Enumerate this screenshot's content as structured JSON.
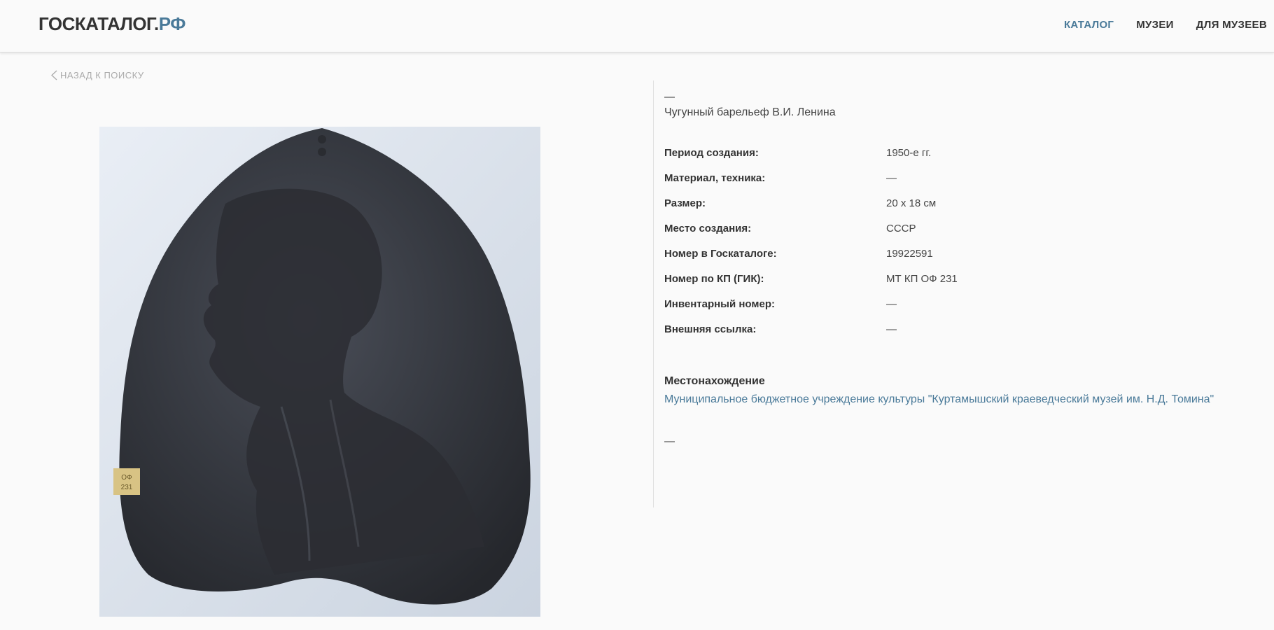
{
  "header": {
    "logo_main": "ГОСКАТАЛОГ.",
    "logo_accent": "РФ",
    "nav": [
      {
        "label": "КАТАЛОГ",
        "active": true
      },
      {
        "label": "МУЗЕИ",
        "active": false
      },
      {
        "label": "ДЛЯ МУЗЕЕВ",
        "active": false
      }
    ]
  },
  "back_link": {
    "label": "НАЗАД К ПОИСКУ",
    "icon": "chevron-left-icon"
  },
  "item": {
    "author": "—",
    "title": "Чугунный барельеф В.И. Ленина",
    "properties": [
      {
        "label": "Период создания:",
        "value": "1950-е гг."
      },
      {
        "label": "Материал, техника:",
        "value": "—"
      },
      {
        "label": "Размер:",
        "value": "20 х 18 см"
      },
      {
        "label": "Место создания:",
        "value": "СССР"
      },
      {
        "label": "Номер в Госкаталоге:",
        "value": "19922591"
      },
      {
        "label": "Номер по КП (ГИК):",
        "value": "МТ КП ОФ 231"
      },
      {
        "label": "Инвентарный номер:",
        "value": "—"
      },
      {
        "label": "Внешняя ссылка:",
        "value": "—"
      }
    ],
    "location_title": "Местонахождение",
    "location_link": "Муниципальное бюджетное учреждение культуры \"Куртамышский краеведческий музей им. Н.Д. Томина\"",
    "footer_dash": "—"
  },
  "photo": {
    "label_text": "ОФ 231"
  },
  "colors": {
    "accent": "#4a7a99",
    "background": "#fafafa",
    "text": "#333333"
  }
}
